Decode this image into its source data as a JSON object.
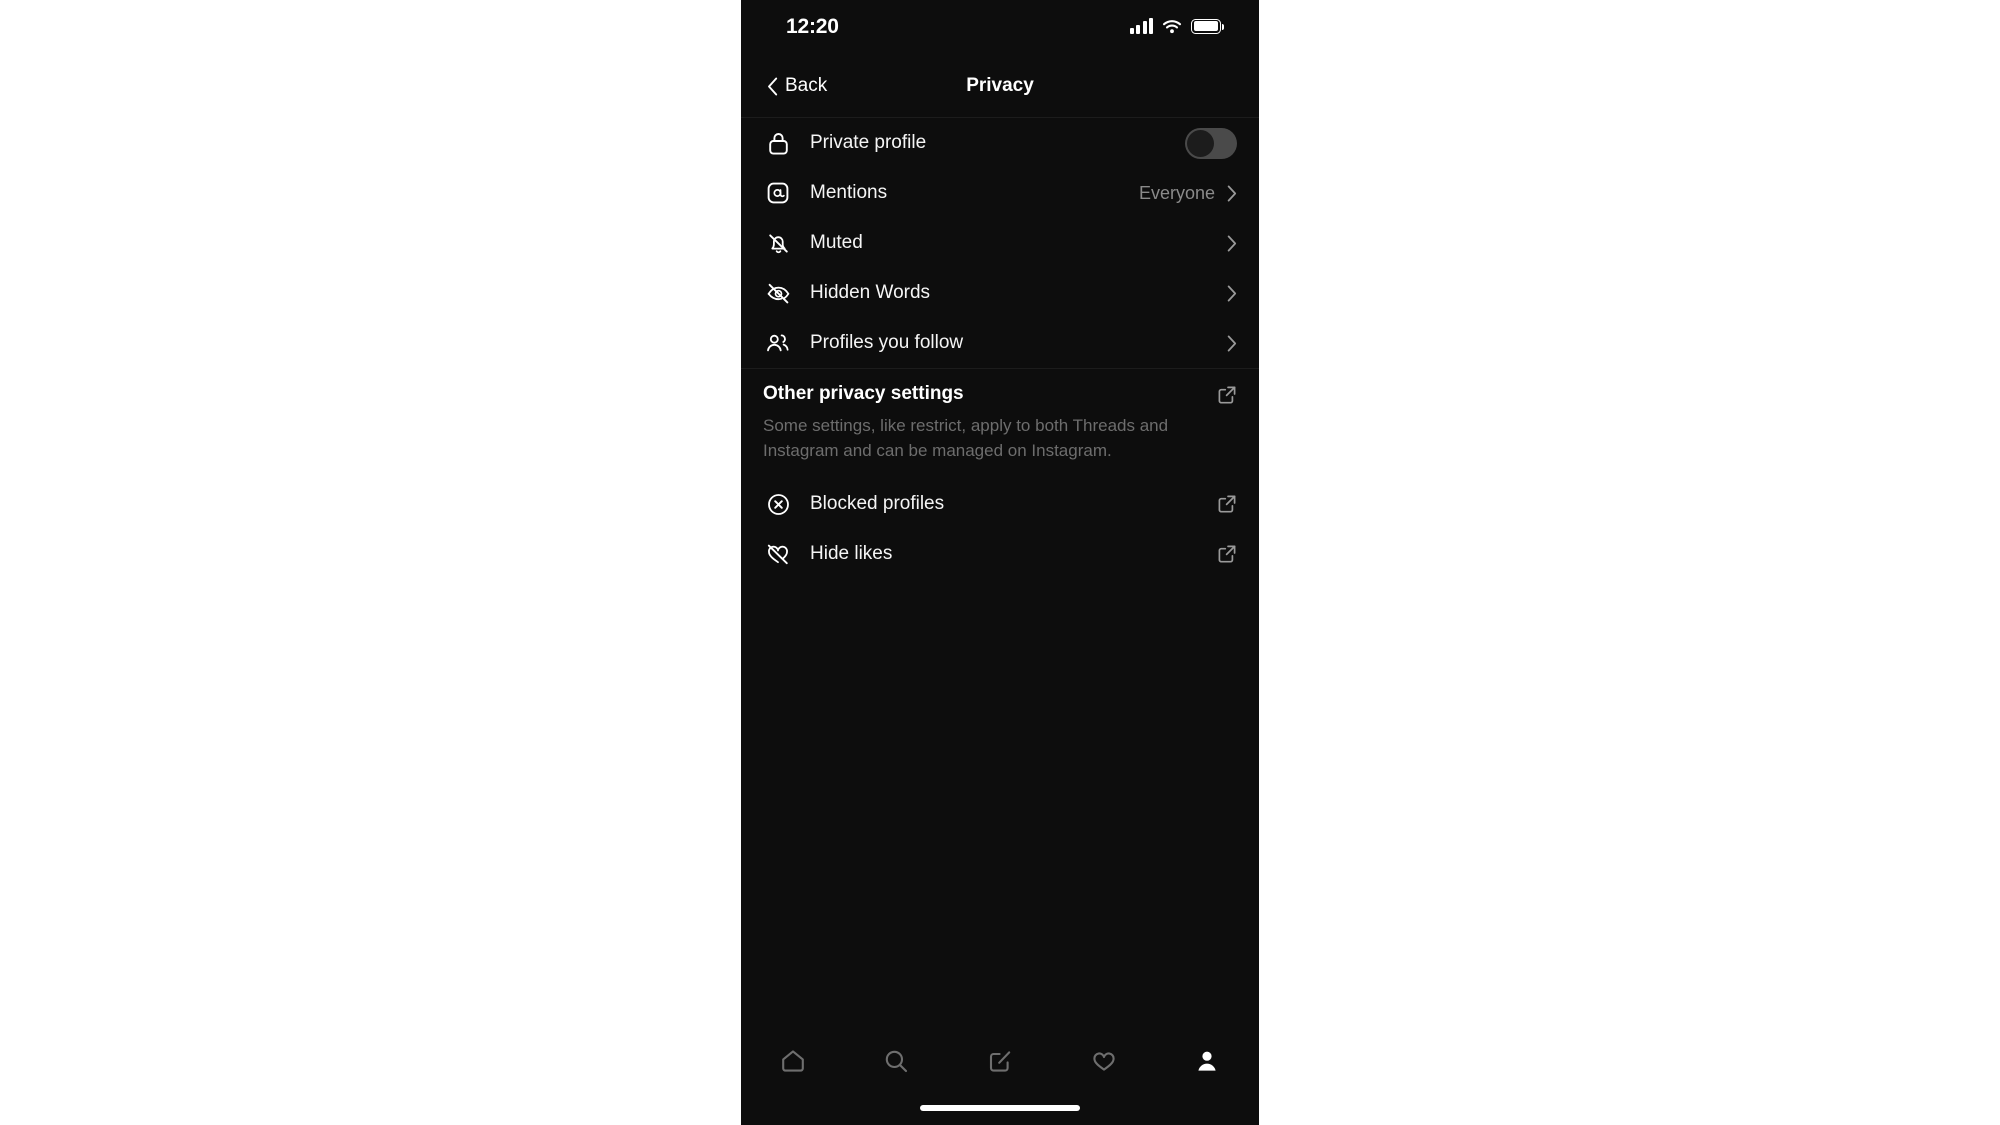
{
  "app": {
    "name": "Threads",
    "background": "#0d0d0d",
    "accent_text": "#ffffff",
    "muted_text": "#6d6d6d",
    "divider": "#1c1c1c"
  },
  "status_bar": {
    "time": "12:20",
    "cellular_icon": "signal-bars-icon",
    "wifi_icon": "wifi-icon",
    "battery_icon": "battery-full-icon"
  },
  "header": {
    "back_label": "Back",
    "back_icon": "chevron-left-icon",
    "title": "Privacy"
  },
  "settings": {
    "items": [
      {
        "label": "Private profile",
        "icon": "lock-icon",
        "control": "toggle",
        "toggle_on": false
      },
      {
        "label": "Mentions",
        "icon": "at-sign-icon",
        "control": "chevron",
        "value": "Everyone"
      },
      {
        "label": "Muted",
        "icon": "bell-slash-icon",
        "control": "chevron",
        "value": ""
      },
      {
        "label": "Hidden Words",
        "icon": "eye-slash-icon",
        "control": "chevron",
        "value": ""
      },
      {
        "label": "Profiles you follow",
        "icon": "people-icon",
        "control": "chevron",
        "value": ""
      }
    ]
  },
  "other_privacy": {
    "title": "Other privacy settings",
    "description": "Some settings, like restrict, apply to both Threads and Instagram and can be managed on Instagram.",
    "external_icon": "external-link-icon",
    "items": [
      {
        "label": "Blocked profiles",
        "icon": "circle-x-icon",
        "control": "external-link"
      },
      {
        "label": "Hide likes",
        "icon": "heart-slash-icon",
        "control": "external-link"
      }
    ]
  },
  "tab_bar": {
    "tabs": [
      {
        "name": "home",
        "icon": "home-icon",
        "active": false
      },
      {
        "name": "search",
        "icon": "search-icon",
        "active": false
      },
      {
        "name": "compose",
        "icon": "compose-icon",
        "active": false
      },
      {
        "name": "activity",
        "icon": "heart-icon",
        "active": false
      },
      {
        "name": "profile",
        "icon": "profile-icon",
        "active": true
      }
    ]
  }
}
